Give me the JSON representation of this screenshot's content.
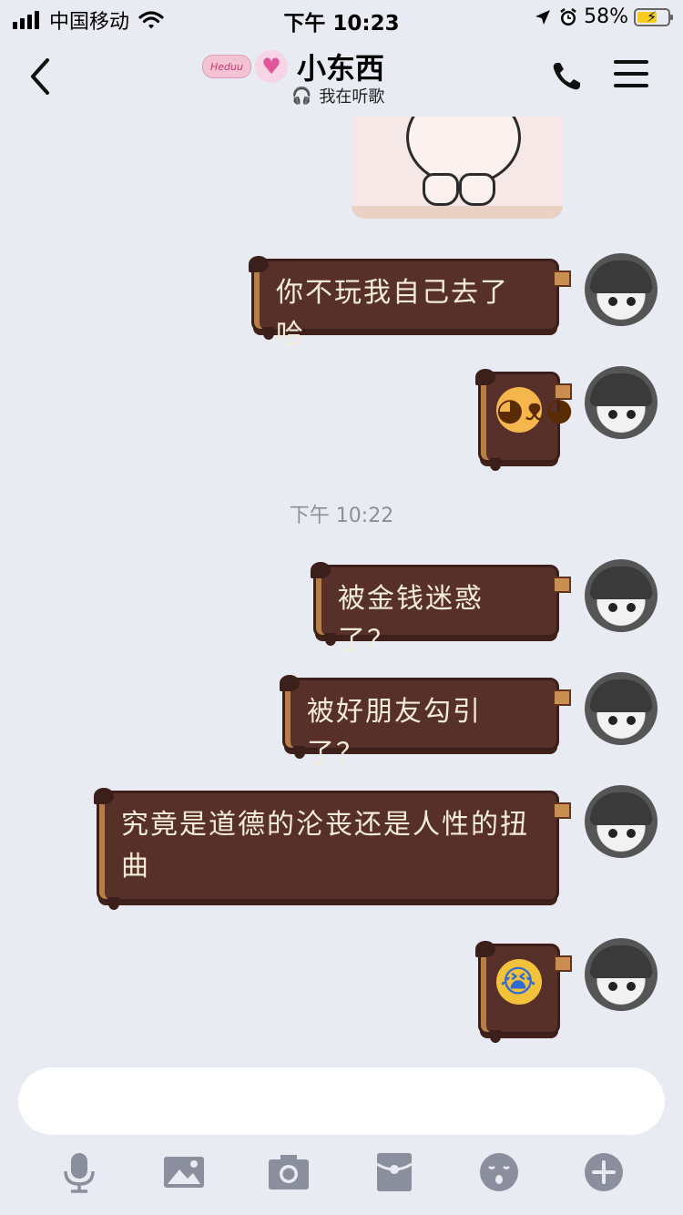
{
  "status_bar": {
    "carrier": "中国移动",
    "time": "下午 10:23",
    "battery": "58%",
    "battery_level": 0.58
  },
  "header": {
    "contact_name": "小东西",
    "badge_text": "Heduu",
    "status_text": "我在听歌"
  },
  "messages": [
    {
      "type": "text",
      "text": "你不玩我自己去了哈"
    },
    {
      "type": "emoji",
      "emoji": "dog-face-icon"
    },
    {
      "type": "text",
      "text": "被金钱迷惑了？"
    },
    {
      "type": "text",
      "text": "被好朋友勾引了？"
    },
    {
      "type": "text",
      "text": "究竟是道德的沦丧还是人性的扭曲"
    },
    {
      "type": "emoji",
      "emoji": "crying-face-icon"
    }
  ],
  "timestamp": "下午 10:22",
  "input": {
    "placeholder": "",
    "value": ""
  },
  "toolbar": [
    "microphone-icon",
    "image-icon",
    "camera-icon",
    "red-packet-icon",
    "emoji-icon",
    "plus-icon"
  ]
}
